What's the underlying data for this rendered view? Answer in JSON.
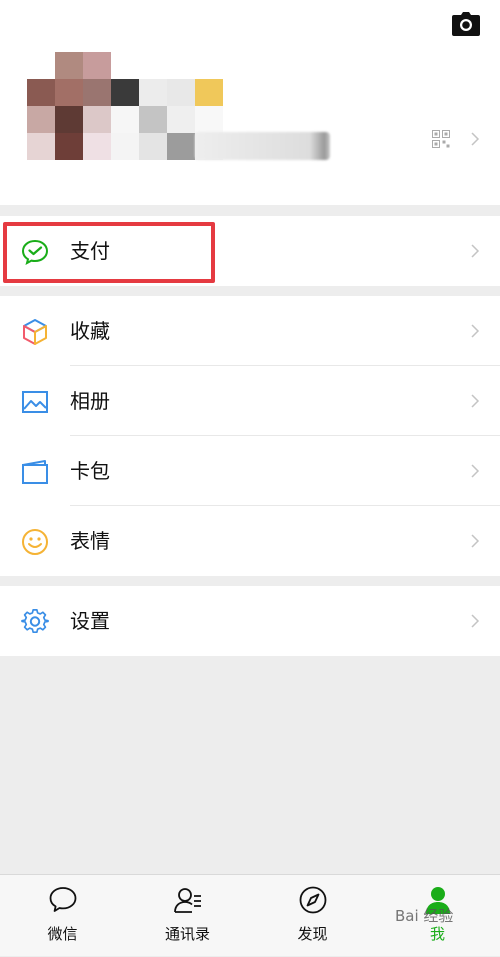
{
  "menu": {
    "pay": "支付",
    "favorites": "收藏",
    "album": "相册",
    "cards": "卡包",
    "stickers": "表情",
    "settings": "设置"
  },
  "tabbar": {
    "chats": "微信",
    "contacts": "通讯录",
    "discover": "发现",
    "me": "我"
  },
  "colors": {
    "accent_green": "#1aad19",
    "highlight_red": "#e53a41",
    "background": "#ededed"
  },
  "icons": {
    "pay": "wechat-pay-icon",
    "favorites": "cube-icon",
    "album": "image-icon",
    "cards": "card-wallet-icon",
    "stickers": "smiley-icon",
    "settings": "gear-icon",
    "profile_qr": "qr-code-icon",
    "camera": "camera-icon"
  },
  "watermark": "Bai 经验"
}
